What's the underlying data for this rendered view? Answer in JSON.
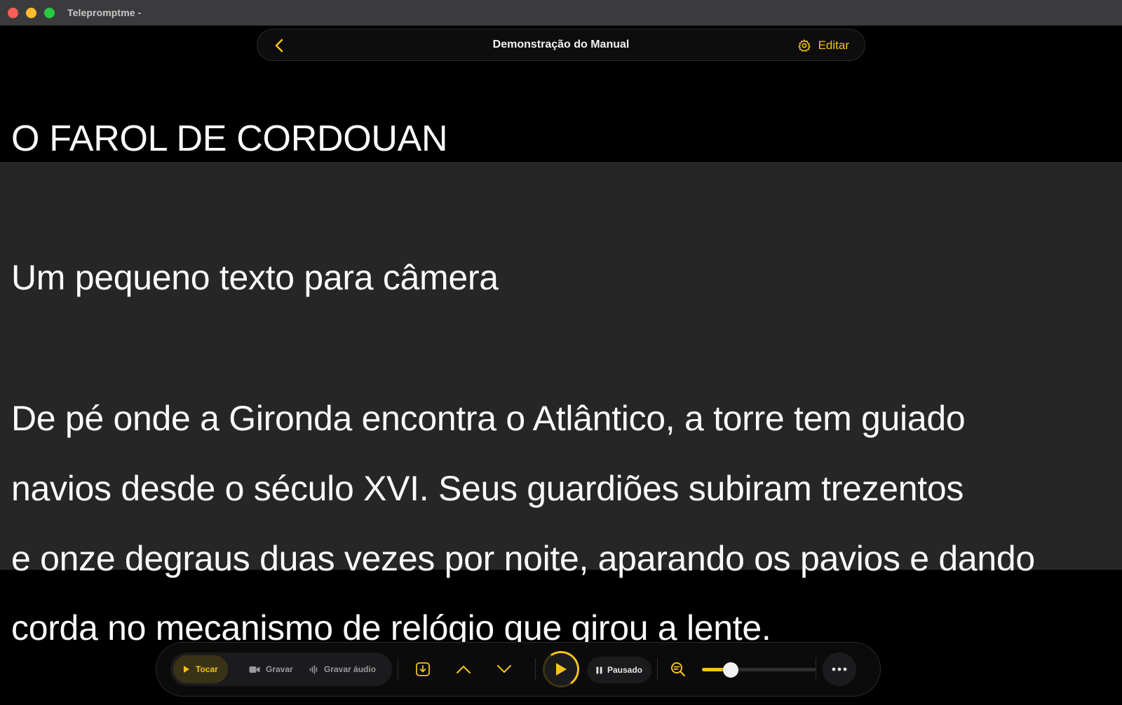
{
  "window": {
    "title": "Telepromptme -"
  },
  "nav": {
    "back_icon": "chevron-left-icon",
    "doc_title": "Demonstração do Manual",
    "edit_icon": "gear-icon",
    "edit_label": "Editar"
  },
  "script": {
    "heading": "O FAROL DE CORDOUAN",
    "lines": [
      "Um pequeno texto para câmera",
      "De pé onde a Gironda encontra o Atlântico, a torre tem guiado",
      "navios desde o século XVI. Seus guardiões subiram trezentos",
      "e onze degraus duas vezes por noite, aparando os pavios e dando",
      "corda no mecanismo de relógio que girou a lente."
    ]
  },
  "controls": {
    "modes": [
      {
        "label": "Tocar",
        "icon": "play-icon",
        "active": true
      },
      {
        "label": "Gravar",
        "icon": "video-camera-icon",
        "active": false
      },
      {
        "label": "Gravar áudio",
        "icon": "waveform-icon",
        "active": false
      }
    ],
    "status_label": "Pausado",
    "status_icon": "pause-icon",
    "zoom_icon": "zoom-out-icon",
    "speed_level": 0.25,
    "more_icon": "ellipsis-icon"
  },
  "colors": {
    "accent": "#f4c21b",
    "background": "#000000",
    "reading_band": "#262626",
    "text": "#fafafa"
  }
}
